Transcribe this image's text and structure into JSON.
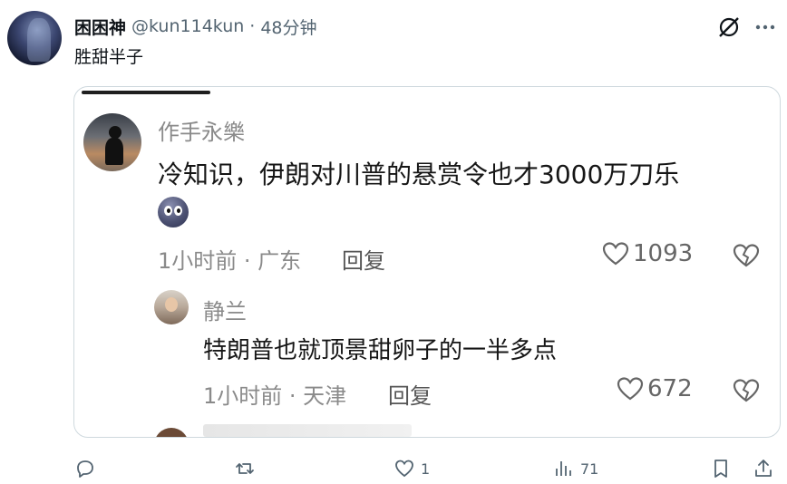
{
  "tweet": {
    "display_name": "困困神",
    "handle": "@kun114kun",
    "separator": "·",
    "time": "48分钟",
    "text": "胜甜半子"
  },
  "comment": {
    "name": "作手永樂",
    "text": "冷知识，伊朗对川普的悬赏令也才3000万刀乐",
    "meta": "1小时前 · 广东",
    "reply_label": "回复",
    "likes": "1093"
  },
  "reply": {
    "name": "静兰",
    "text": "特朗普也就顶景甜卵子的一半多点",
    "meta": "1小时前 · 天津",
    "reply_label": "回复",
    "likes": "672"
  },
  "actions": {
    "likes": "1",
    "views": "71"
  },
  "icons": [
    "grok-icon",
    "more-icon",
    "heart-icon",
    "broken-heart-icon",
    "reply-icon",
    "retweet-icon",
    "like-icon",
    "views-icon",
    "bookmark-icon",
    "share-icon"
  ]
}
